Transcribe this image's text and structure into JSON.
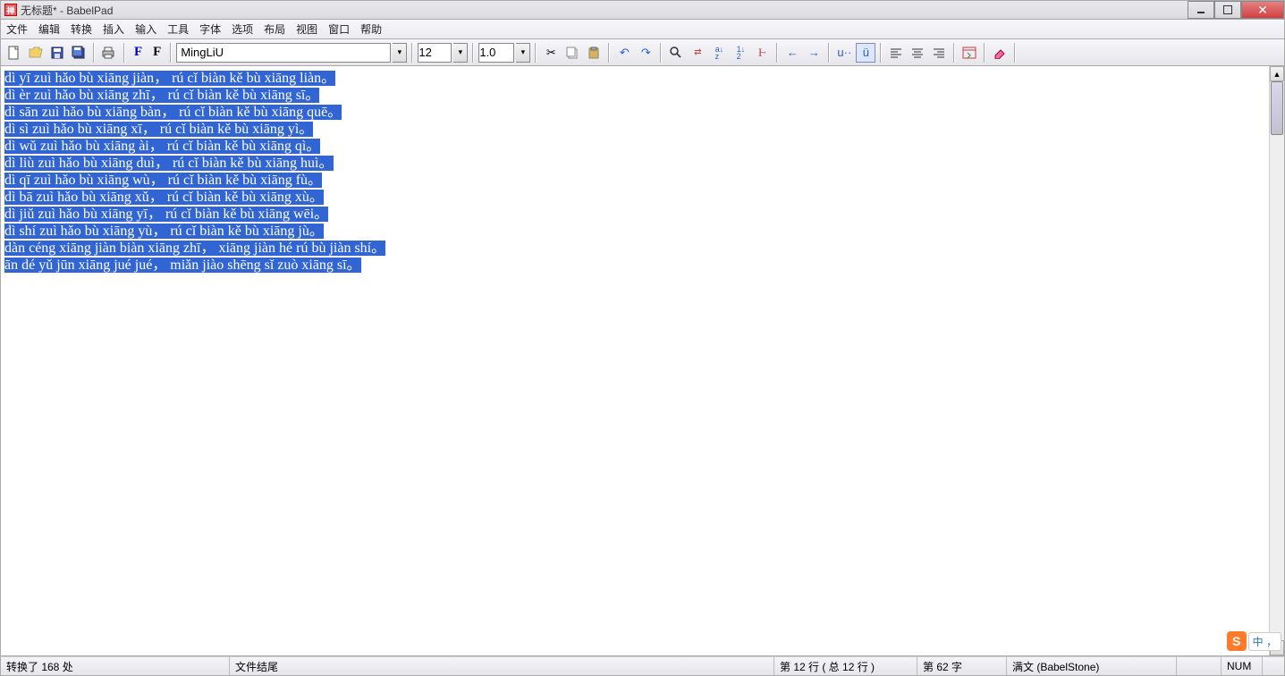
{
  "window": {
    "title": "无标题* - BabelPad"
  },
  "menu": {
    "file": "文件",
    "edit": "编辑",
    "convert": "转换",
    "insert": "插入",
    "input": "输入",
    "tools": "工具",
    "font": "字体",
    "options": "选项",
    "layout": "布局",
    "view": "视图",
    "window": "窗口",
    "help": "帮助"
  },
  "toolbar": {
    "font_name": "MingLiU",
    "font_size": "12",
    "line_spacing": "1.0"
  },
  "editor": {
    "lines": [
      "dì yī zuì hǎo bù xiāng jiàn， rú cǐ biàn kě bù xiāng liàn。",
      "dì èr zuì hǎo bù xiāng zhī， rú cǐ biàn kě bù xiāng sī。",
      "dì sān zuì hǎo bù xiāng bàn， rú cǐ biàn kě bù xiāng quē。",
      "dì sì zuì hǎo bù xiāng xī， rú cǐ biàn kě bù xiāng yì。",
      "dì wǔ zuì hǎo bù xiāng ài， rú cǐ biàn kě bù xiāng qì。",
      "dì liù zuì hǎo bù xiāng duì， rú cǐ biàn kě bù xiāng huì。",
      "dì qī zuì hǎo bù xiāng wù， rú cǐ biàn kě bù xiāng fù。",
      "dì bā zuì hǎo bù xiāng xǔ， rú cǐ biàn kě bù xiāng xù。",
      "dì jiǔ zuì hǎo bù xiāng yī， rú cǐ biàn kě bù xiāng wēi。",
      "dì shí zuì hǎo bù xiāng yù， rú cǐ biàn kě bù xiāng jù。",
      "dàn céng xiāng jiàn biàn xiāng zhī， xiāng jiàn hé rú bù jiàn shí。",
      "ān dé yǔ jūn xiāng jué jué， miǎn jiào shēng sǐ zuò xiāng sī。"
    ]
  },
  "status": {
    "left": "转换了 168 处",
    "mid": "文件结尾",
    "line": "第 12 行 ( 总 12 行 )",
    "col": "第 62 字",
    "font_info": "满文 (BabelStone)",
    "num": "NUM"
  },
  "ime": {
    "brand": "S",
    "lang": "中 ，"
  }
}
